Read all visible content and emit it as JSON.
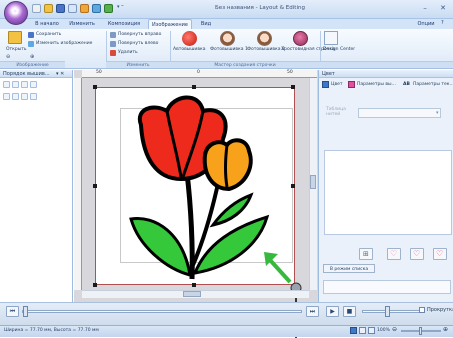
{
  "window": {
    "title": "Без названия - Layout & Editing",
    "help": "?"
  },
  "titlebar_controls": {
    "minimize": "–",
    "close": "✕"
  },
  "tabs": [
    {
      "label": "В начало"
    },
    {
      "label": "Изменить"
    },
    {
      "label": "Композиция"
    },
    {
      "label": "Изображение"
    },
    {
      "label": "Вид"
    }
  ],
  "options_label": "Опции",
  "ribbon": {
    "open_label": "Открыть",
    "save_label": "Сохранить",
    "change_image_label": "Изменить изображение",
    "rotate_right_label": "Повернуть вправо",
    "rotate_left_label": "Повернуть влево",
    "delete_label": "Удалить",
    "apple_label": "Автовышивка",
    "photo1_label": "Фотовышивка 1",
    "photo2_label": "Фотовышивка 2",
    "cross_label": "Хростовидная строчка",
    "design_center_label": "Design Center",
    "group_image": "Изображение",
    "group_edit": "Изменить",
    "group_wizard": "Мастер создания строчки"
  },
  "left_panel": {
    "title": "Порядок вышив...",
    "pin": "▾ ✕"
  },
  "ruler": {
    "labels": [
      "50",
      "0",
      "50"
    ]
  },
  "right_panel": {
    "header": "Цвет",
    "tab_color": "Цвет",
    "tab_sew_params": "Параметры вы...",
    "tab_text_params": "Параметры тек...",
    "field_label": "Таблица нитей",
    "list_mode_button": "В режим списка"
  },
  "player": {
    "scroll_label": "Прокрутка"
  },
  "status": {
    "dimensions": "Ширина = 77.70 мм, Высота = 77.70 мм",
    "zoom": "100%"
  },
  "colors": {
    "tulip_red": "#ee2a1c",
    "tulip_orange": "#f7a21a",
    "leaf_green": "#34c83a",
    "arrow_green": "#36b93c",
    "accent_blue": "#1e395b"
  }
}
